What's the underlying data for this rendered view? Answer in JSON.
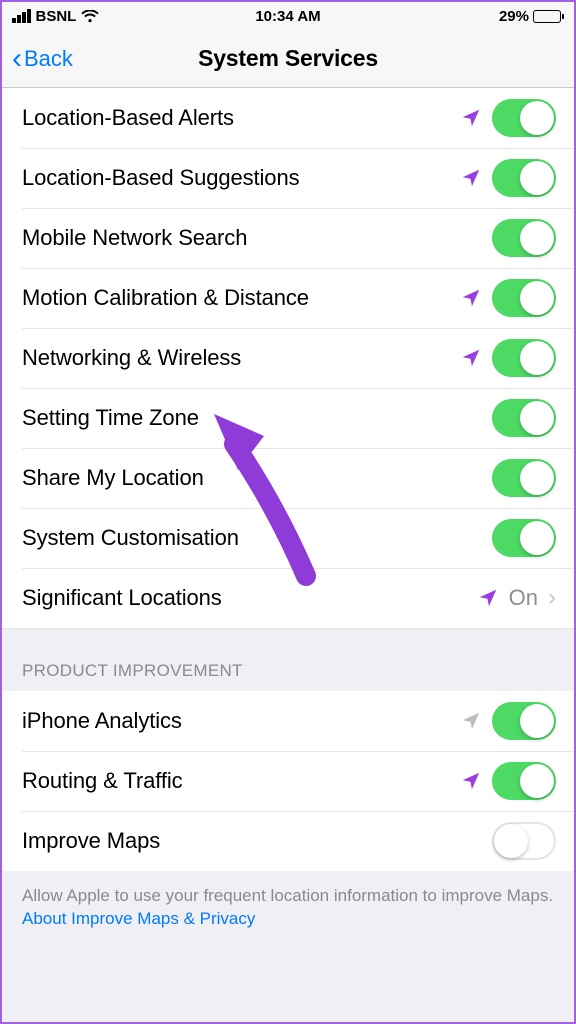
{
  "status": {
    "carrier": "BSNL",
    "time": "10:34 AM",
    "battery_pct": "29%"
  },
  "nav": {
    "back": "Back",
    "title": "System Services"
  },
  "groups": [
    {
      "header": null,
      "rows": [
        {
          "label": "Location-Based Alerts",
          "arrow": "purple",
          "toggle": true
        },
        {
          "label": "Location-Based Suggestions",
          "arrow": "purple",
          "toggle": true
        },
        {
          "label": "Mobile Network Search",
          "arrow": null,
          "toggle": true
        },
        {
          "label": "Motion Calibration & Distance",
          "arrow": "purple",
          "toggle": true
        },
        {
          "label": "Networking & Wireless",
          "arrow": "purple",
          "toggle": true
        },
        {
          "label": "Setting Time Zone",
          "arrow": null,
          "toggle": true
        },
        {
          "label": "Share My Location",
          "arrow": null,
          "toggle": true
        },
        {
          "label": "System Customisation",
          "arrow": null,
          "toggle": true
        },
        {
          "label": "Significant Locations",
          "arrow": "purple",
          "value": "On",
          "disclosure": true
        }
      ]
    },
    {
      "header": "PRODUCT IMPROVEMENT",
      "rows": [
        {
          "label": "iPhone Analytics",
          "arrow": "gray",
          "toggle": true
        },
        {
          "label": "Routing & Traffic",
          "arrow": "purple",
          "toggle": true
        },
        {
          "label": "Improve Maps",
          "arrow": null,
          "toggle": false
        }
      ]
    }
  ],
  "footer": {
    "text": "Allow Apple to use your frequent location information to improve Maps. ",
    "link": "About Improve Maps & Privacy"
  }
}
